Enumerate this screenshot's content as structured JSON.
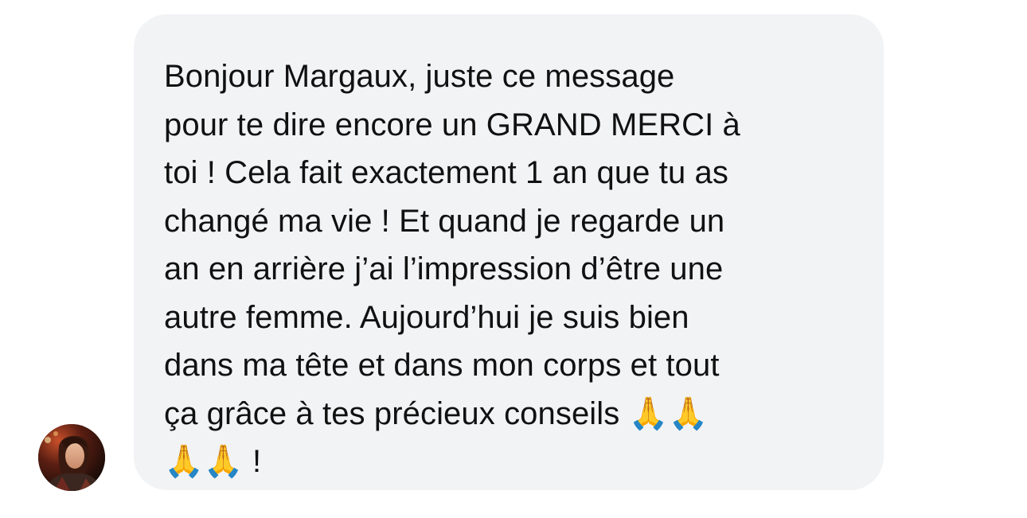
{
  "message": {
    "text": "Bonjour Margaux, juste ce message\npour te dire encore un GRAND MERCI à\ntoi ! Cela fait exactement 1 an que tu as\nchangé ma vie ! Et quand je regarde un\nan en arrière j’ai l’impression d’être une\nautre femme. Aujourd’hui je suis bien\ndans ma tête et dans mon corps et tout\nça grâce à tes précieux conseils 🙏🙏\n🙏🙏 !"
  },
  "colors": {
    "bubble_background": "#f2f3f5",
    "text": "#111111"
  },
  "avatar": {
    "icon": "sender-avatar-photo"
  }
}
